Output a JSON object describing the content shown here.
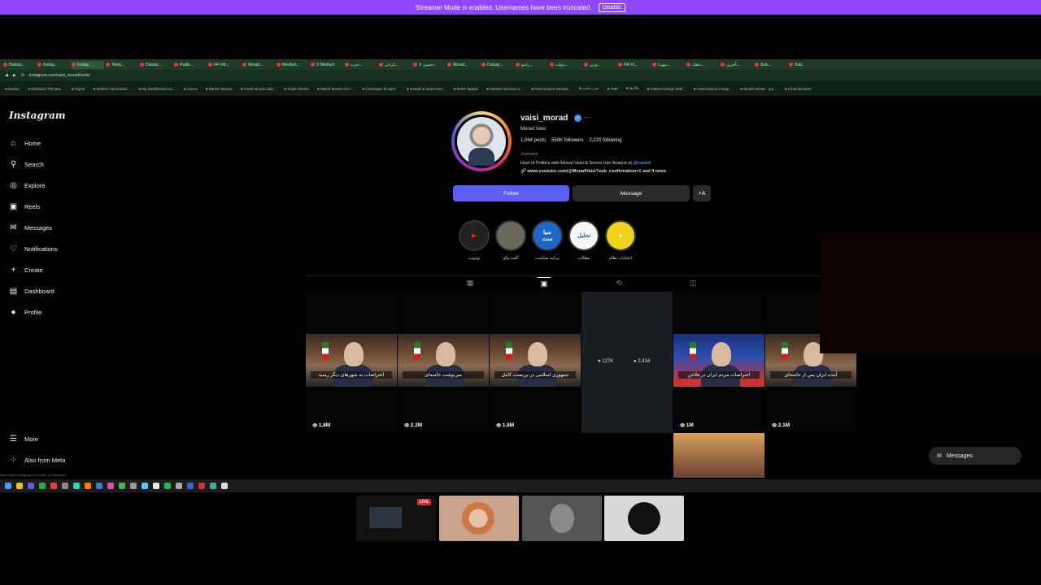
{
  "banner": {
    "text": "Streamer Mode is enabled. Usernames have been truncated.",
    "button": "Disable"
  },
  "browser": {
    "address": "instagram.com/vaisi_morad/reels/",
    "tabs": [
      "Dubaiy...",
      "Instag...",
      "Instag...",
      "Teleg...",
      "Dubaiy...",
      "Radio...",
      "FA Vid...",
      "Morad...",
      "Medium...",
      "X Medium",
      "حزب...",
      "ایرانی...",
      "X حسین...",
      "Morad...",
      "Dubaiy...",
      "رادیو...",
      "دولت...",
      "وزیر...",
      "FM Vi...",
      "مهرنا...",
      "دلقک...",
      "آخرین...",
      "Sub...",
      "Sub..."
    ],
    "bookmarks": [
      "Mosaic",
      "Mobiloud 'Pet Mat...",
      "Figma",
      "Walkeri commando...",
      "My Dashboard Acc...",
      "Canva",
      "Bitdew Mosaic",
      "Fresh Mosaic add...",
      "Trade Stonks",
      "Watch Movies On I...",
      "Chessquiz fit Oper...",
      "Roadie & more Ants...",
      "DOM Tapado",
      "Internet Services 1...",
      "Free Invoice Genera...",
      "مدیر سایت",
      "TMP",
      "بلاگ‌فا",
      "Pattern Design Wiki...",
      "Command & Conqu...",
      "Stonks winter - Ipe...",
      "All Bookmarks"
    ]
  },
  "sidebar": {
    "logo": "Instagram",
    "items": [
      {
        "label": "Home",
        "icon": "home-icon",
        "glyph": "⌂"
      },
      {
        "label": "Search",
        "icon": "search-icon",
        "glyph": "⚲"
      },
      {
        "label": "Explore",
        "icon": "explore-icon",
        "glyph": "◎"
      },
      {
        "label": "Reels",
        "icon": "reels-icon",
        "glyph": "▣"
      },
      {
        "label": "Messages",
        "icon": "messenger-icon",
        "glyph": "✉"
      },
      {
        "label": "Notifications",
        "icon": "heart-icon",
        "glyph": "♡"
      },
      {
        "label": "Create",
        "icon": "plus-icon",
        "glyph": "+"
      },
      {
        "label": "Dashboard",
        "icon": "dashboard-icon",
        "glyph": "▤"
      },
      {
        "label": "Profile",
        "icon": "avatar-icon",
        "glyph": "●"
      }
    ],
    "more": "More",
    "meta": "Also from Meta"
  },
  "profile": {
    "username": "vaisi_morad",
    "full_name": "Morad Vaisi",
    "posts": "1,064 posts",
    "followers": "550K followers",
    "following": "2,220 following",
    "category": "Journalist",
    "bio": "Host of Politics with Morad Vaisi & Senior Iran Analyst at",
    "bio_mention": "@iranintl",
    "link": "www.youtube.com/@MoradVaisi?sub_confirmation=1 and 4 more",
    "follow": "Follow",
    "message": "Message",
    "suggest": "+A"
  },
  "highlights": [
    {
      "label": "یوتیوب",
      "icon": "youtube-icon",
      "bg": "#222",
      "text": "▶"
    },
    {
      "label": "گفت وگو",
      "icon": "light-icon",
      "bg": "#6b6a5a",
      "text": ""
    },
    {
      "label": "برنامه سیاست",
      "icon": "siasat-icon",
      "bg": "#1f67c6",
      "text": "سیا\nست"
    },
    {
      "label": "مطالب",
      "icon": "tahlil-icon",
      "bg": "#f5f5f5",
      "text": "تحلیل"
    },
    {
      "label": "انتخابات نظام",
      "icon": "election-icon",
      "bg": "#f2d21a",
      "text": "●"
    }
  ],
  "grid": {
    "row1": [
      {
        "caption": "اعتراضات به شهرهای دیگر رسید",
        "views": "1.8M"
      },
      {
        "caption": "سرنوشت خامنه‌ای",
        "views": "2.3M"
      },
      {
        "caption": "جمهوری اسلامی در بن‌بست کامل",
        "views": "1.8M"
      },
      {
        "caption": "",
        "views": ""
      },
      {
        "caption": "اعتراضات مردم ایران در فلاخن",
        "views": "1M"
      },
      {
        "caption": "آینده ایران پس از خامنه‌ای",
        "views": "2.1M"
      }
    ],
    "hover_likes": "127K",
    "hover_comments": "2,434"
  },
  "messages_pill": "Messages",
  "taskbar_url": "https://www.instagram.com/vaisi_morad/reels/",
  "stream": {
    "live": "LIVE"
  }
}
